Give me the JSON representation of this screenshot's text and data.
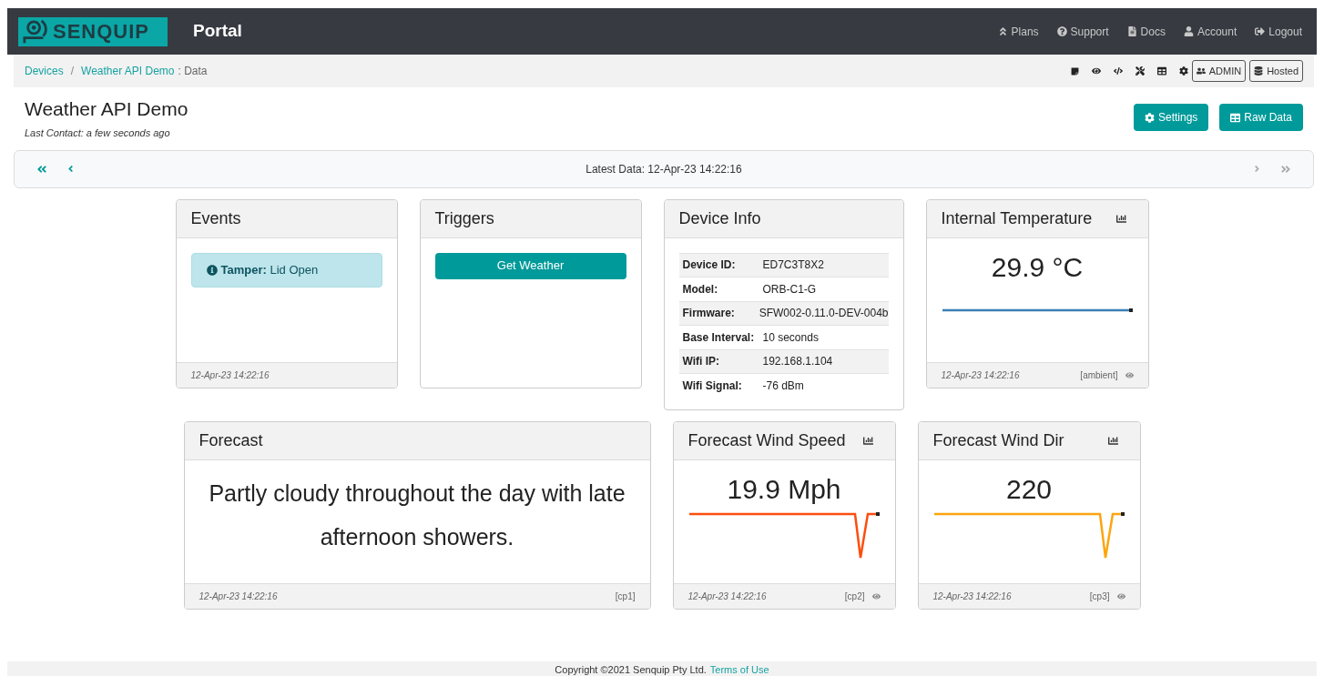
{
  "navbar": {
    "logo_text": "SENQUIP",
    "title": "Portal",
    "links": [
      {
        "label": "Plans"
      },
      {
        "label": "Support"
      },
      {
        "label": "Docs"
      },
      {
        "label": "Account"
      },
      {
        "label": "Logout"
      }
    ]
  },
  "breadcrumb": {
    "items": [
      "Devices",
      "Weather API Demo"
    ],
    "separator": "/",
    "current": ": Data",
    "badges": [
      "ADMIN",
      "Hosted"
    ]
  },
  "header": {
    "title": "Weather API Demo",
    "subtitle": "Last Contact: a few seconds ago",
    "buttons": [
      {
        "label": "Settings"
      },
      {
        "label": "Raw Data"
      }
    ]
  },
  "pager": {
    "label": "Latest Data: 12-Apr-23 14:22:16",
    "prev_disabled": false,
    "next_disabled": true
  },
  "rows": [
    [
      {
        "kind": "events",
        "title": "Events",
        "alert_label": "Tamper:",
        "alert_text": "Lid Open",
        "time": "12-Apr-23 14:22:16"
      },
      {
        "kind": "triggers",
        "title": "Triggers",
        "buttons": [
          "Get Weather"
        ]
      },
      {
        "kind": "info",
        "title": "Device Info",
        "fields": [
          {
            "label": "Device ID:",
            "value": "ED7C3T8X2"
          },
          {
            "label": "Model:",
            "value": "ORB-C1-G"
          },
          {
            "label": "Firmware:",
            "value": "SFW002-0.11.0-DEV-004b"
          },
          {
            "label": "Base Interval:",
            "value": "10 seconds"
          },
          {
            "label": "Wifi IP:",
            "value": "192.168.1.104"
          },
          {
            "label": "Wifi Signal:",
            "value": "-76 dBm"
          }
        ]
      },
      {
        "kind": "value",
        "title": "Internal Temperature",
        "value": "29.9 °C",
        "color": "#3a7fb5",
        "time": "12-Apr-23 14:22:16",
        "tag": "[ambient]"
      }
    ],
    [
      {
        "kind": "text",
        "title": "Forecast",
        "text": "Partly cloudy throughout the day with late afternoon showers.",
        "time": "12-Apr-23 14:22:16",
        "tag": "[cp1]"
      },
      {
        "kind": "value",
        "title": "Forecast Wind Speed",
        "value": "19.9 Mph",
        "color": "#fc4e0e",
        "time": "12-Apr-23 14:22:16",
        "tag": "[cp2]"
      },
      {
        "kind": "value",
        "title": "Forecast Wind Dir",
        "value": "220",
        "color": "#fca50f",
        "time": "12-Apr-23 14:22:16",
        "tag": "[cp3]"
      }
    ]
  ],
  "footer": {
    "text": "Copyright ©2021 Senquip Pty Ltd.",
    "link": "Terms of Use"
  }
}
